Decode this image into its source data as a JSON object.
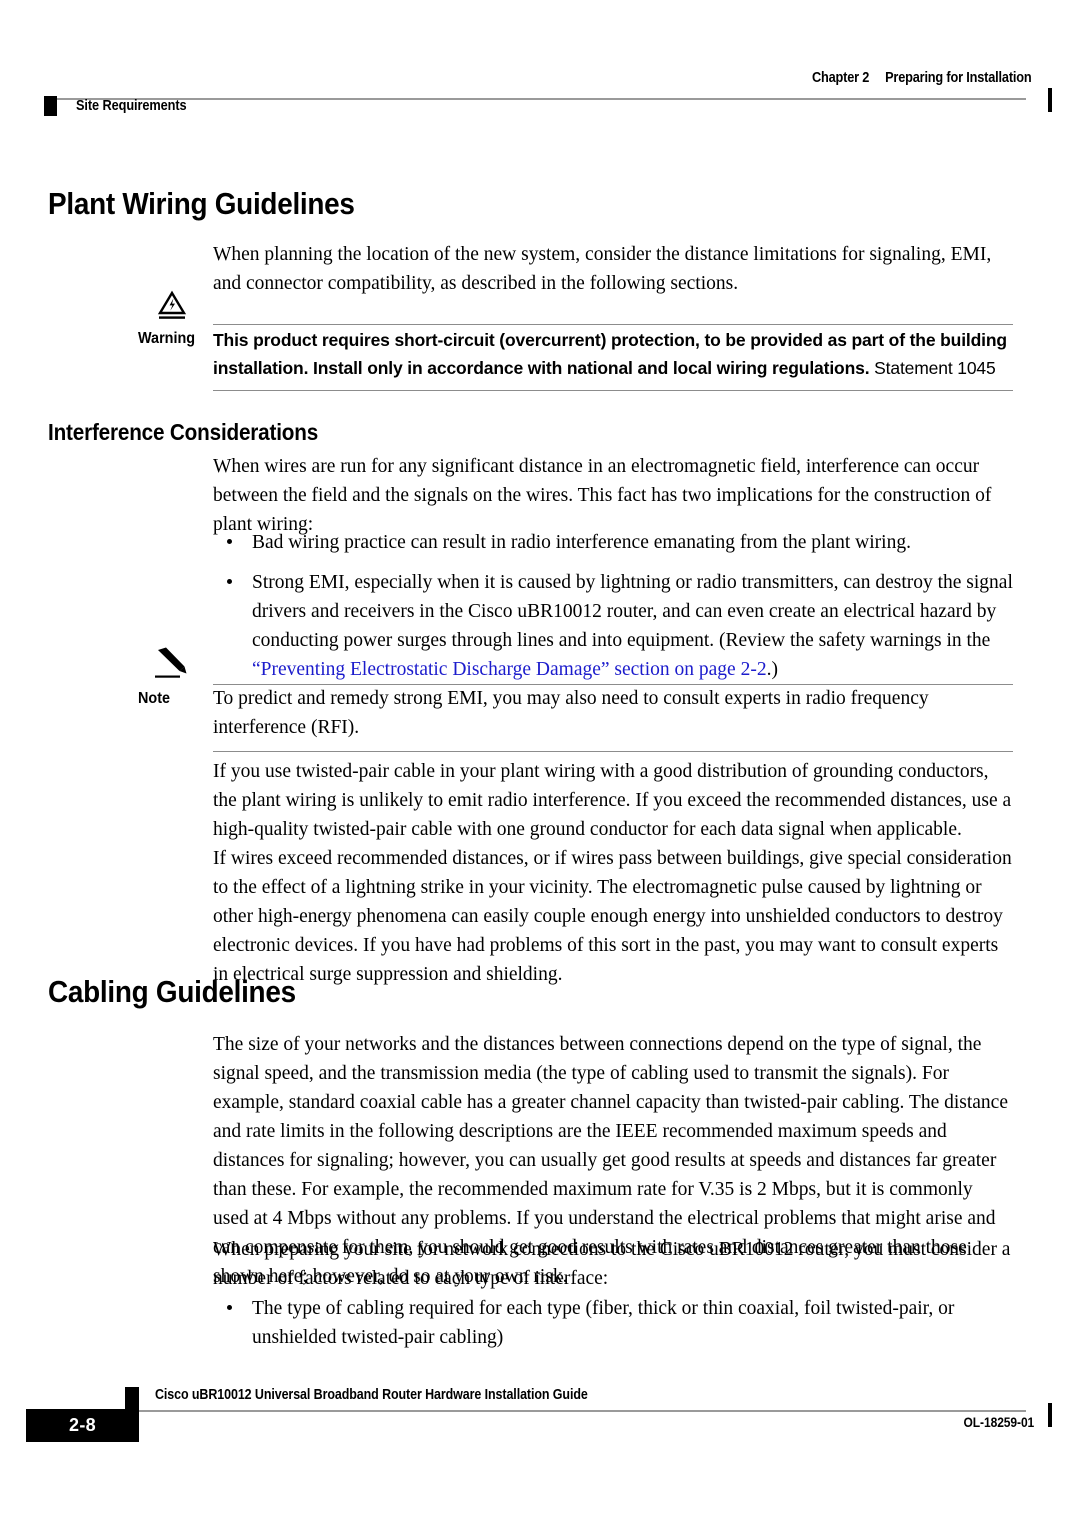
{
  "header": {
    "chapter_label": "Chapter 2",
    "chapter_title": "Preparing for Installation",
    "section_label": "Site Requirements"
  },
  "main": {
    "heading_plant_wiring": "Plant Wiring Guidelines",
    "intro_para": "When planning the location of the new system, consider the distance limitations for signaling, EMI, and connector compatibility, as described in the following sections.",
    "warning": {
      "label": "Warning",
      "icon": "warning-triangle-icon",
      "text": "This product requires short-circuit (overcurrent) protection, to be provided as part of the building installation. Install only in accordance with national and local wiring regulations.",
      "statement": "Statement 1045"
    },
    "heading_interference": "Interference Considerations",
    "interference_para": "When wires are run for any significant distance in an electromagnetic field, interference can occur between the field and the signals on the wires. This fact has two implications for the construction of plant wiring:",
    "interference_bullets": [
      {
        "text": "Bad wiring practice can result in radio interference emanating from the plant wiring."
      },
      {
        "text_before": "Strong EMI, especially when it is caused by lightning or radio transmitters, can destroy the signal drivers and receivers in the Cisco uBR10012 router, and can even create an electrical hazard by conducting power surges through lines and into equipment. (Review the safety warnings in the ",
        "link": "“Preventing Electrostatic Discharge Damage” section on page 2-2",
        "text_after": ".)"
      }
    ],
    "note": {
      "label": "Note",
      "icon": "pencil-icon",
      "text": "To predict and remedy strong EMI, you may also need to consult experts in radio frequency interference (RFI)."
    },
    "twisted_pair_para": "If you use twisted-pair cable in your plant wiring with a good distribution of grounding conductors, the plant wiring is unlikely to emit radio interference. If you exceed the recommended distances, use a high-quality twisted-pair cable with one ground conductor for each data signal when applicable.",
    "lightning_para": "If wires exceed recommended distances, or if wires pass between buildings, give special consideration to the effect of a lightning strike in your vicinity. The electromagnetic pulse caused by lightning or other high-energy phenomena can easily couple enough energy into unshielded conductors to destroy electronic devices. If you have had problems of this sort in the past, you may want to consult experts in electrical surge suppression and shielding.",
    "heading_cabling": "Cabling Guidelines",
    "cabling_para": "The size of your networks and the distances between connections depend on the type of signal, the signal speed, and the transmission media (the type of cabling used to transmit the signals). For example, standard coaxial cable has a greater channel capacity than twisted-pair cabling. The distance and rate limits in the following descriptions are the IEEE recommended maximum speeds and distances for signaling; however, you can usually get good results at speeds and distances far greater than these. For example, the recommended maximum rate for V.35 is 2 Mbps, but it is commonly used at 4 Mbps without any problems. If you understand the electrical problems that might arise and can compensate for them, you should get good results with rates and distances greater than those shown here; however, do so at your own risk.",
    "preparing_para": "When preparing your site for network connections to the Cisco uBR10012 router, you must consider a number of factors related to each type of interface:",
    "cabling_bullets": [
      {
        "text": "The type of cabling required for each type (fiber, thick or thin coaxial, foil twisted-pair, or unshielded twisted-pair cabling)"
      }
    ]
  },
  "footer": {
    "page_number": "2-8",
    "guide_title": "Cisco uBR10012 Universal Broadband Router Hardware Installation Guide",
    "doc_id": "OL-18259-01"
  },
  "colors": {
    "link": "#1c1ccc",
    "rule": "#9a9a9a",
    "ink": "#000000"
  }
}
